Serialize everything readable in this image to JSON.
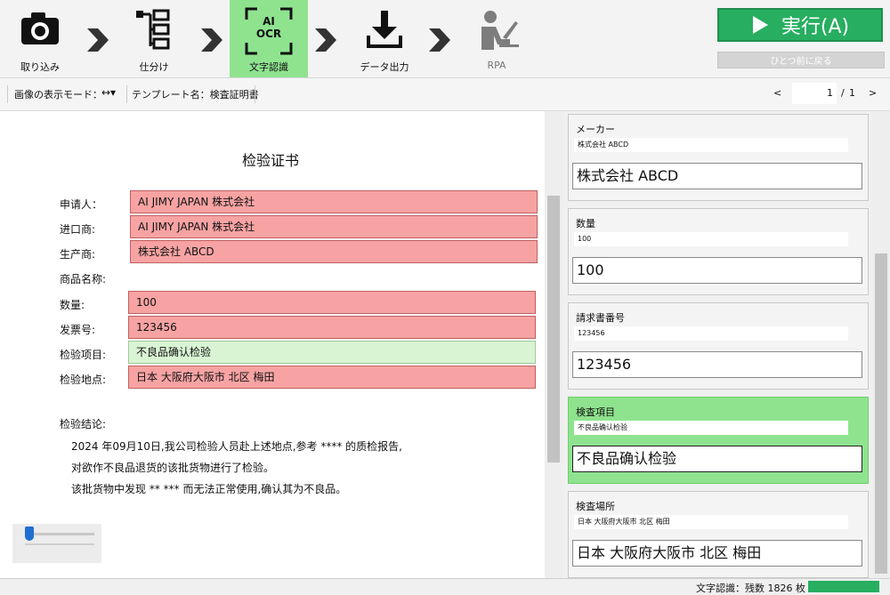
{
  "toolbar": {
    "steps": [
      {
        "label": "取り込み",
        "icon": "camera-icon"
      },
      {
        "label": "仕分け",
        "icon": "sort-tree-icon"
      },
      {
        "label": "文字認識",
        "icon": "ai-ocr-icon",
        "icon_text_1": "AI",
        "icon_text_2": "OCR"
      },
      {
        "label": "データ出力",
        "icon": "download-icon"
      },
      {
        "label": "RPA",
        "icon": "robot-worker-icon"
      }
    ],
    "run_label": "実行(A)",
    "back_label": "ひとつ前に戻る"
  },
  "subbar": {
    "display_mode_label": "画像の表示モード：",
    "display_mode_value": "↔▾",
    "template_label": "テンプレート名：検査証明書",
    "prev": "<",
    "page_current": "1",
    "page_sep": "/",
    "page_total": "1",
    "next": ">"
  },
  "document": {
    "title": "检验证书",
    "rows": [
      {
        "label": "申请人：",
        "value": "AI JIMY JAPAN 株式会社"
      },
      {
        "label": "进口商:",
        "value": "AI JIMY JAPAN 株式会社"
      },
      {
        "label": "生产商:",
        "value": "株式会社 ABCD"
      },
      {
        "label": "商品名称:",
        "value": ""
      },
      {
        "label": "数量:",
        "value": "100"
      },
      {
        "label": "发票号:",
        "value": "123456"
      },
      {
        "label": "检验项目:",
        "value": "不良品确认检验"
      },
      {
        "label": "检验地点:",
        "value": "日本 大阪府大阪市 北区 梅田"
      }
    ],
    "conclusion_label": "检验结论:",
    "paragraphs": [
      "2024 年09月10日,我公司检验人员赴上述地点,参考 **** 的质检报告,",
      "对欲作不良品退货的该批货物进行了检验。",
      "该批货物中发现 ** *** 而无法正常使用,确认其为不良品。"
    ]
  },
  "fields": [
    {
      "title": "メーカー",
      "raw": "株式会社 ABCD",
      "value": "株式会社 ABCD"
    },
    {
      "title": "数量",
      "raw": "100",
      "value": "100"
    },
    {
      "title": "請求書番号",
      "raw": "123456",
      "value": "123456"
    },
    {
      "title": "検査項目",
      "raw": "不良品确认检验",
      "value": "不良品确认检验"
    },
    {
      "title": "検査場所",
      "raw": "日本 大阪府大阪市 北区 梅田",
      "value": "日本 大阪府大阪市 北区 梅田"
    }
  ],
  "status": {
    "text": "文字認識：残数 1826 枚"
  },
  "colors": {
    "active_step": "#8fe38f",
    "run_button": "#27ae60",
    "field_error": "#f7a3a3",
    "field_ok": "#d9f4d3"
  }
}
